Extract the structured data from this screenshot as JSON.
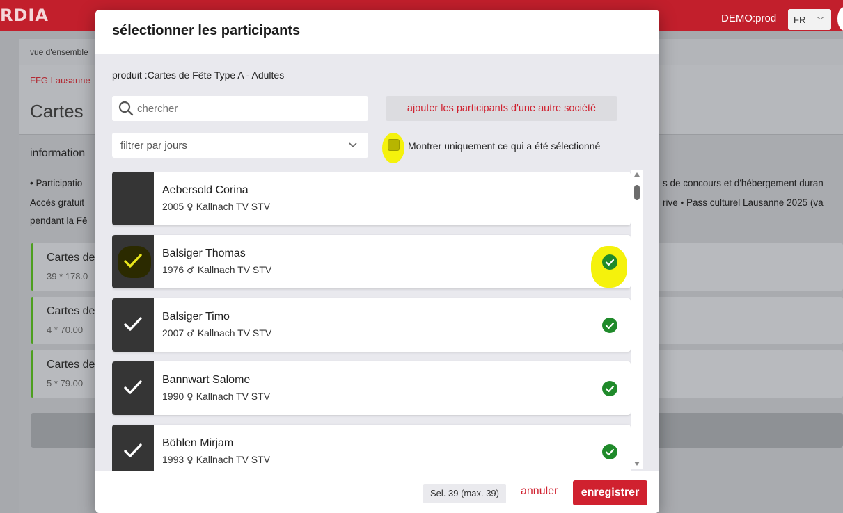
{
  "app": {
    "brand": "RDIA",
    "env": "DEMO:prod",
    "lang": "FR",
    "breadcrumb": "vue d'ensemble",
    "org": "FFG Lausanne",
    "title": "Cartes",
    "info_title": "information",
    "info_lines": [
      "• Participatio",
      "Accès gratuit",
      "pendant la Fê"
    ],
    "info_right_lines": [
      "s de concours et d'hébergement duran",
      "rive • Pass culturel Lausanne 2025 (va"
    ],
    "cards": [
      {
        "title": "Cartes de",
        "sub": "39 * 178.0"
      },
      {
        "title": "Cartes de",
        "sub": "4 * 70.00"
      },
      {
        "title": "Cartes de",
        "sub": "5 * 79.00"
      }
    ]
  },
  "modal": {
    "title": "sélectionner les participants",
    "product": "produit :Cartes de Fête Type A - Adultes",
    "search_placeholder": "chercher",
    "add_label": "ajouter les participants d'une autre société",
    "filter_label": "filtrer par jours",
    "only_selected_label": "Montrer uniquement ce qui a été sélectionné",
    "participants": [
      {
        "name": "Aebersold Corina",
        "year": "2005",
        "gender": "♀",
        "club": "Kallnach TV STV",
        "selected": false
      },
      {
        "name": "Balsiger Thomas",
        "year": "1976",
        "gender": "♂",
        "club": "Kallnach TV STV",
        "selected": true
      },
      {
        "name": "Balsiger Timo",
        "year": "2007",
        "gender": "♂",
        "club": "Kallnach TV STV",
        "selected": true
      },
      {
        "name": "Bannwart Salome",
        "year": "1990",
        "gender": "♀",
        "club": "Kallnach TV STV",
        "selected": true
      },
      {
        "name": "Böhlen Mirjam",
        "year": "1993",
        "gender": "♀",
        "club": "Kallnach TV STV",
        "selected": true
      }
    ],
    "count": "Sel. 39 (max. 39)",
    "cancel_label": "annuler",
    "save_label": "enregistrer"
  },
  "colors": {
    "accent": "#d0212f",
    "ok": "#1f8a2a",
    "highlight": "#f5f20c"
  }
}
